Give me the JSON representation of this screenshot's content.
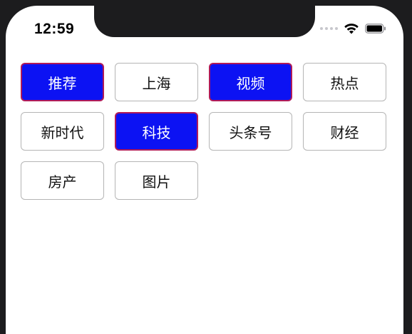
{
  "status_bar": {
    "time": "12:59"
  },
  "tags": [
    {
      "label": "推荐",
      "selected": true
    },
    {
      "label": "上海",
      "selected": false
    },
    {
      "label": "视频",
      "selected": true
    },
    {
      "label": "热点",
      "selected": false
    },
    {
      "label": "新时代",
      "selected": false
    },
    {
      "label": "科技",
      "selected": true
    },
    {
      "label": "头条号",
      "selected": false
    },
    {
      "label": "财经",
      "selected": false
    },
    {
      "label": "房产",
      "selected": false
    },
    {
      "label": "图片",
      "selected": false
    }
  ],
  "colors": {
    "selected_fill": "#0c12f3",
    "selected_border": "#b01b58",
    "unselected_border": "#b5b5b5"
  }
}
